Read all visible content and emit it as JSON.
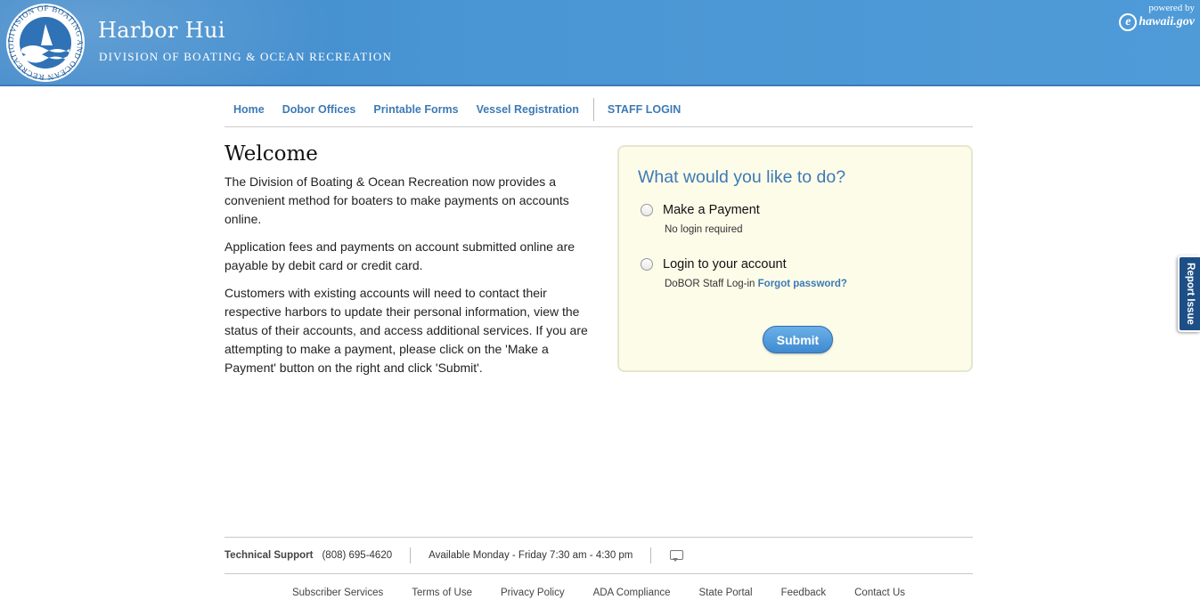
{
  "header": {
    "title": "Harbor Hui",
    "subtitle": "DIVISION OF BOATING & OCEAN RECREATION",
    "seal_text": "DIVISION OF BOATING AND OCEAN RECREATION",
    "powered_by": "powered by",
    "powered_brand": "hawaii.gov"
  },
  "nav": {
    "items": [
      "Home",
      "Dobor Offices",
      "Printable Forms",
      "Vessel Registration"
    ],
    "staff_login": "STAFF LOGIN"
  },
  "welcome": {
    "heading": "Welcome",
    "paragraphs": [
      "The Division of Boating & Ocean Recreation now provides a convenient method for boaters to make payments on accounts online.",
      "Application fees and payments on account submitted online are payable by debit card or credit card.",
      "Customers with existing accounts will need to contact their respective harbors to update their personal information, view the status of their accounts, and access additional services. If you are attempting to make a payment, please click on the 'Make a Payment' button on the right and click 'Submit'."
    ]
  },
  "action_box": {
    "heading": "What would you like to do?",
    "options": [
      {
        "label": "Make a Payment",
        "hint": "No login required"
      },
      {
        "label": "Login to your account",
        "hint": "DoBOR Staff Log-in",
        "hint_link": "Forgot password?"
      }
    ],
    "submit_label": "Submit"
  },
  "report_issue": "Report Issue",
  "support": {
    "label": "Technical Support",
    "phone": "(808) 695-4620",
    "hours": "Available Monday - Friday 7:30 am - 4:30 pm"
  },
  "footer_links": [
    "Subscriber Services",
    "Terms of Use",
    "Privacy Policy",
    "ADA Compliance",
    "State Portal",
    "Feedback",
    "Contact Us"
  ],
  "colors": {
    "header_blue": "#4a95d3",
    "link_blue": "#3d7ab5",
    "box_bg": "#fdfce9",
    "report_tab": "#1d4f86"
  }
}
